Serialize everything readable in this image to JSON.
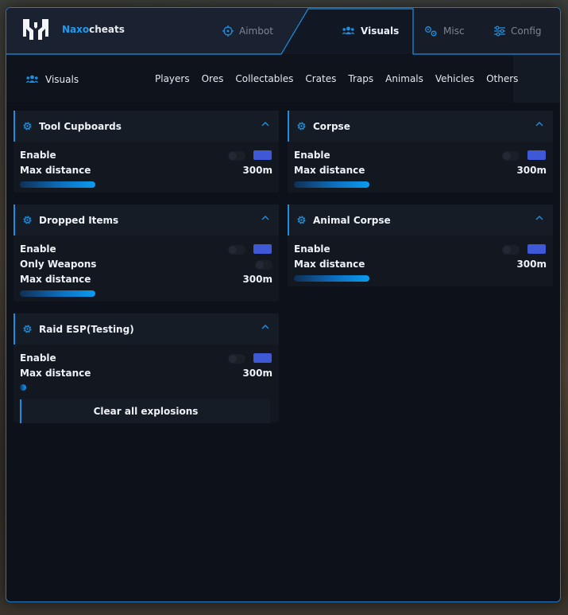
{
  "app": {
    "brand_accent": "Naxo",
    "brand_rest": "cheats",
    "accent_color": "#1e8fe0"
  },
  "top_tabs": [
    {
      "label": "Aimbot",
      "icon": "crosshair-icon",
      "active": false
    },
    {
      "label": "Visuals",
      "icon": "users-icon",
      "active": true
    },
    {
      "label": "Misc",
      "icon": "cogs-icon",
      "active": false
    },
    {
      "label": "Config",
      "icon": "sliders-icon",
      "active": false
    }
  ],
  "subbar": {
    "title": "Visuals",
    "categories": [
      "Players",
      "Ores",
      "Collectables",
      "Crates",
      "Traps",
      "Animals",
      "Vehicles",
      "Others"
    ]
  },
  "panels": {
    "tool_cupboards": {
      "title": "Tool Cupboards",
      "enable": "Enable",
      "max_distance": "Max distance",
      "distance_value": "300m",
      "slider_level": 1.0
    },
    "corpse": {
      "title": "Corpse",
      "enable": "Enable",
      "max_distance": "Max distance",
      "distance_value": "300m",
      "slider_level": 1.0
    },
    "dropped_items": {
      "title": "Dropped Items",
      "enable": "Enable",
      "only_weapons": "Only Weapons",
      "max_distance": "Max distance",
      "distance_value": "300m",
      "slider_level": 1.0
    },
    "animal_corpse": {
      "title": "Animal Corpse",
      "enable": "Enable",
      "max_distance": "Max distance",
      "distance_value": "300m",
      "slider_level": 1.0
    },
    "raid_esp": {
      "title": "Raid ESP(Testing)",
      "enable": "Enable",
      "max_distance": "Max distance",
      "distance_value": "300m",
      "slider_level": 0.05,
      "clear_button": "Clear all explosions"
    }
  }
}
